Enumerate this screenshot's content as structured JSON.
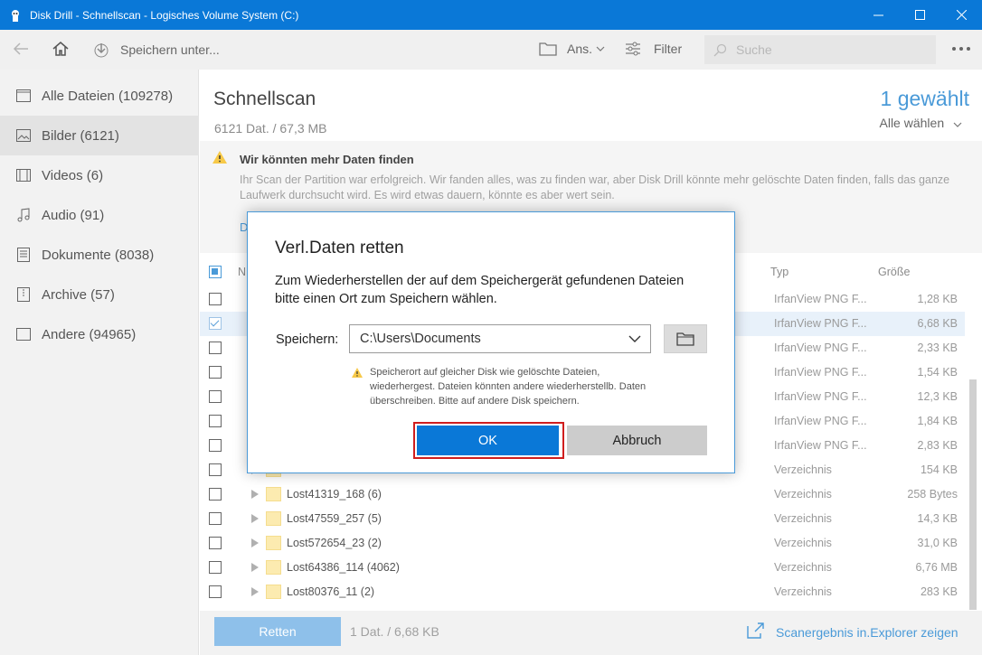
{
  "window": {
    "title": "Disk Drill - Schnellscan - Logisches Volume System (C:)"
  },
  "toolbar": {
    "save_as_label": "Speichern unter...",
    "view_label": "Ans.",
    "filter_label": "Filter",
    "search_placeholder": "Suche"
  },
  "sidebar": {
    "items": [
      {
        "label": "Alle Dateien (109278)"
      },
      {
        "label": "Bilder (6121)"
      },
      {
        "label": "Videos (6)"
      },
      {
        "label": "Audio (91)"
      },
      {
        "label": "Dokumente (8038)"
      },
      {
        "label": "Archive (57)"
      },
      {
        "label": "Andere (94965)"
      }
    ]
  },
  "main": {
    "title": "Schnellscan",
    "subtitle": "6121 Dat. / 67,3 MB",
    "selected_count": "1 gewählt",
    "select_all": "Alle wählen"
  },
  "banner": {
    "title": "Wir könnten mehr Daten finden",
    "text": "Ihr Scan der Partition war erfolgreich. Wir fanden alles, was zu finden war, aber Disk Drill könnte mehr gelöschte Daten finden, falls das ganze Laufwerk durchsucht wird. Es wird etwas dauern, könnte es aber wert sein.",
    "link": "D"
  },
  "table": {
    "headers": {
      "name": "N",
      "type": "Typ",
      "size": "Größe"
    },
    "rows": [
      {
        "name": "",
        "type": "IrfanView PNG F...",
        "size": "1,28 KB",
        "checked": false,
        "folder": false
      },
      {
        "name": "",
        "type": "IrfanView PNG F...",
        "size": "6,68 KB",
        "checked": true,
        "folder": false
      },
      {
        "name": "",
        "type": "IrfanView PNG F...",
        "size": "2,33 KB",
        "checked": false,
        "folder": false
      },
      {
        "name": "",
        "type": "IrfanView PNG F...",
        "size": "1,54 KB",
        "checked": false,
        "folder": false
      },
      {
        "name": "",
        "type": "IrfanView PNG F...",
        "size": "12,3 KB",
        "checked": false,
        "folder": false
      },
      {
        "name": "",
        "type": "IrfanView PNG F...",
        "size": "1,84 KB",
        "checked": false,
        "folder": false
      },
      {
        "name": "",
        "type": "IrfanView PNG F...",
        "size": "2,83 KB",
        "checked": false,
        "folder": false
      },
      {
        "name": "",
        "type": "Verzeichnis",
        "size": "154 KB",
        "checked": false,
        "folder": true
      },
      {
        "name": "Lost41319_168 (6)",
        "type": "Verzeichnis",
        "size": "258 Bytes",
        "checked": false,
        "folder": true
      },
      {
        "name": "Lost47559_257 (5)",
        "type": "Verzeichnis",
        "size": "14,3 KB",
        "checked": false,
        "folder": true
      },
      {
        "name": "Lost572654_23 (2)",
        "type": "Verzeichnis",
        "size": "31,0 KB",
        "checked": false,
        "folder": true
      },
      {
        "name": "Lost64386_114 (4062)",
        "type": "Verzeichnis",
        "size": "6,76 MB",
        "checked": false,
        "folder": true
      },
      {
        "name": "Lost80376_11 (2)",
        "type": "Verzeichnis",
        "size": "283 KB",
        "checked": false,
        "folder": true
      }
    ]
  },
  "bottom": {
    "recover_label": "Retten",
    "info": "1 Dat. / 6,68 KB",
    "explorer_link": "Scanergebnis in.Explorer zeigen"
  },
  "dialog": {
    "title": "Verl.Daten retten",
    "text": "Zum Wiederherstellen der auf dem Speichergerät gefundenen Dateien bitte einen Ort zum Speichern wählen.",
    "save_label": "Speichern:",
    "save_path": "C:\\Users\\Documents",
    "warning": "Speicherort auf gleicher Disk wie gelöschte Dateien, wiederhergest. Dateien könnten andere wiederherstellb. Daten überschreiben. Bitte auf andere Disk speichern.",
    "ok_label": "OK",
    "cancel_label": "Abbruch"
  },
  "colors": {
    "titlebar": "#0a78d7",
    "accent": "#4a9ad8",
    "ok_button": "#0a78d7",
    "highlight_frame": "#d01e1e"
  }
}
